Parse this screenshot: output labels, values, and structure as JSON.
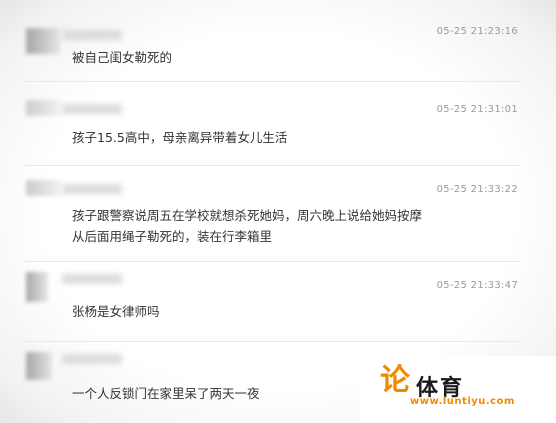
{
  "comments": [
    {
      "time": "05-25 21:23:16",
      "text": "被自己闺女勒死的"
    },
    {
      "time": "05-25 21:31:01",
      "text": "孩子15.5高中，母亲离异带着女儿生活"
    },
    {
      "time": "05-25 21:33:22",
      "line1": "孩子跟警察说周五在学校就想杀死她妈，周六晚上说给她妈按摩",
      "line2": "从后面用绳子勒死的，装在行李箱里"
    },
    {
      "time": "05-25 21:33:47",
      "text": "张杨是女律师吗"
    },
    {
      "text": "一个人反锁门在家里呆了两天一夜"
    }
  ],
  "watermark": {
    "glyph": "论",
    "name": "体育",
    "url": "www.luntiyu.com",
    "accent_color": "#f28a00"
  }
}
